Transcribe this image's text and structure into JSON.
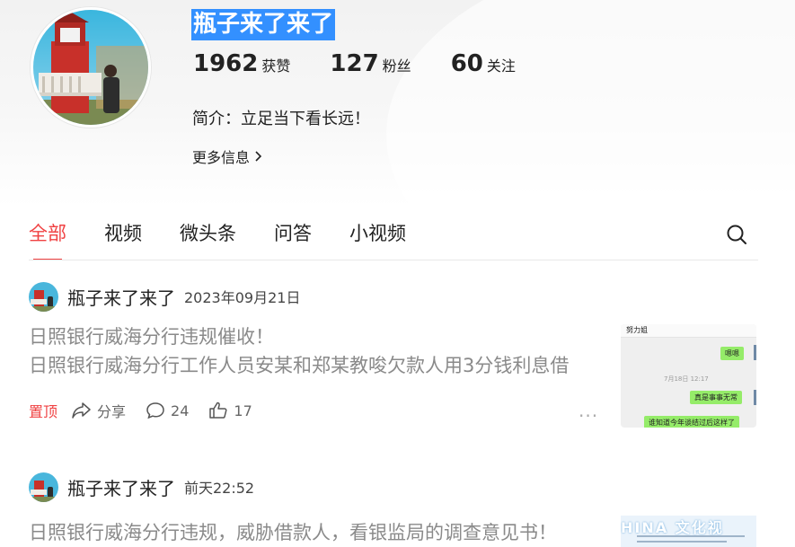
{
  "profile": {
    "name": "瓶子来了来了",
    "stats": [
      {
        "num": "1962",
        "label": "获赞"
      },
      {
        "num": "127",
        "label": "粉丝"
      },
      {
        "num": "60",
        "label": "关注"
      }
    ],
    "bio": "简介：立足当下看长远！",
    "more": "更多信息"
  },
  "tabs": [
    "全部",
    "视频",
    "微头条",
    "问答",
    "小视频"
  ],
  "posts": [
    {
      "author": "瓶子来了来了",
      "time": "2023年09月21日",
      "title": "日照银行威海分行违规催收！",
      "body": "日照银行威海分行工作人员安某和郑某教唆欠款人用3分钱利息借",
      "pinned": "置顶",
      "share": "分享",
      "comments": "24",
      "likes": "17",
      "more": "···",
      "thumb": {
        "contact": "努力姐",
        "msg1": "嗯嗯",
        "date": "7月18日 12:17",
        "msg2": "真是事事无常",
        "msg3": "谁知道今年谈结过后这样了"
      }
    },
    {
      "author": "瓶子来了来了",
      "time": "前天22:52",
      "title": "日照银行威海分行违规，威胁借款人，看银监局的调查意见书！",
      "thumb_watermark": "HINA 文化视"
    }
  ],
  "colors": {
    "accent": "#f04142",
    "highlight": "#3390ff"
  }
}
